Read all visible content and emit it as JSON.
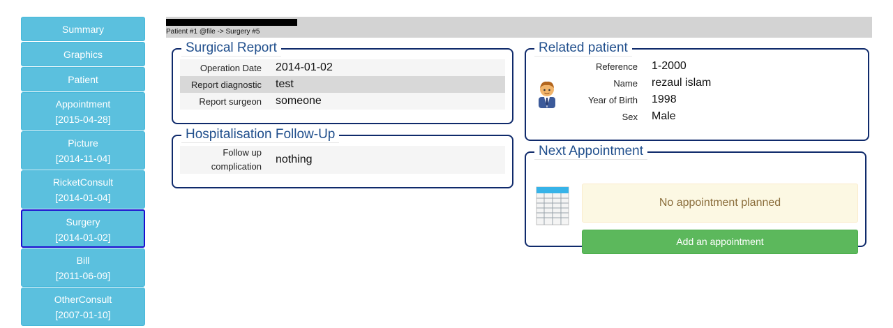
{
  "sidebar": {
    "items": [
      {
        "label": "Summary",
        "date": ""
      },
      {
        "label": "Graphics",
        "date": ""
      },
      {
        "label": "Patient",
        "date": ""
      },
      {
        "label": "Appointment",
        "date": "[2015-04-28]"
      },
      {
        "label": "Picture",
        "date": "[2014-11-04]"
      },
      {
        "label": "RicketConsult",
        "date": "[2014-01-04]"
      },
      {
        "label": "Surgery",
        "date": "[2014-01-02]"
      },
      {
        "label": "Bill",
        "date": "[2011-06-09]"
      },
      {
        "label": "OtherConsult",
        "date": "[2007-01-10]"
      }
    ]
  },
  "header": {
    "breadcrumb": "Patient #1 @file -> Surgery #5"
  },
  "surgical_report": {
    "title": "Surgical Report",
    "rows": [
      {
        "key": "Operation Date",
        "value": "2014-01-02"
      },
      {
        "key": "Report diagnostic",
        "value": "test"
      },
      {
        "key": "Report surgeon",
        "value": "someone"
      }
    ]
  },
  "hospitalisation": {
    "title": "Hospitalisation Follow-Up",
    "rows": [
      {
        "key_line1": "Follow up",
        "key_line2": "complication",
        "value": "nothing"
      }
    ]
  },
  "related_patient": {
    "title": "Related patient",
    "avatar_icon": "patient-avatar-icon",
    "rows": [
      {
        "key": "Reference",
        "value": "1-2000"
      },
      {
        "key": "Name",
        "value": "rezaul islam"
      },
      {
        "key": "Year of Birth",
        "value": "1998"
      },
      {
        "key": "Sex",
        "value": "Male"
      }
    ]
  },
  "next_appointment": {
    "title": "Next Appointment",
    "calendar_icon": "calendar-icon",
    "notice": "No appointment planned",
    "add_button": "Add an appointment"
  },
  "colors": {
    "nav_button": "#5bc0de",
    "nav_active_border": "#1a0ecf",
    "panel_border": "#0f2a6b",
    "legend_text": "#1f4e8c",
    "add_button": "#5cb85c",
    "notice_bg": "#fcf8e3",
    "notice_text": "#8a6d3b"
  }
}
